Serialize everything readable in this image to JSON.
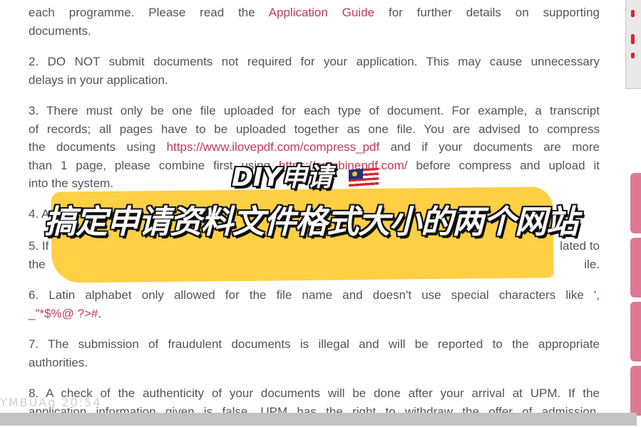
{
  "document": {
    "paragraphs": [
      {
        "id": "1",
        "lines": [
          {
            "segs": [
              {
                "t": "each programme. Please read the "
              },
              {
                "t": "Application Guide",
                "link": true
              },
              {
                "t": " for further details on supporting"
              }
            ]
          },
          {
            "segs": [
              {
                "t": "documents."
              }
            ],
            "last": true
          }
        ]
      },
      {
        "id": "2",
        "lines": [
          {
            "segs": [
              {
                "t": "2. DO NOT submit documents not required for your application. This may cause unnecessary"
              }
            ]
          },
          {
            "segs": [
              {
                "t": "delays in your application."
              }
            ],
            "last": true
          }
        ]
      },
      {
        "id": "3",
        "lines": [
          {
            "segs": [
              {
                "t": "3. There must only be one file uploaded for each type of document. For example, a transcript"
              }
            ]
          },
          {
            "segs": [
              {
                "t": "of records; all pages have to be uploaded together as one file. You are advised to compress"
              }
            ]
          },
          {
            "segs": [
              {
                "t": "the documents using "
              },
              {
                "t": "https://www.ilovepdf.com/compress_pdf",
                "link": true
              },
              {
                "t": " and if your documents are more"
              }
            ]
          },
          {
            "segs": [
              {
                "t": "than 1 page, please combine first using "
              },
              {
                "t": "https://combinepdf.com/",
                "link": true
              },
              {
                "t": " before compress and upload it"
              }
            ]
          },
          {
            "segs": [
              {
                "t": "into the system."
              }
            ],
            "last": true
          }
        ]
      },
      {
        "id": "4",
        "lines": [
          {
            "segs": [
              {
                "t": "4. A"
              }
            ],
            "last": true
          }
        ]
      },
      {
        "id": "5",
        "lines": [
          {
            "segs": [
              {
                "t": "5. If"
              }
            ],
            "tail": "lated to",
            "last": true
          },
          {
            "segs": [
              {
                "t": "the"
              }
            ],
            "tail": "ile.",
            "last": true
          }
        ]
      },
      {
        "id": "6",
        "lines": [
          {
            "segs": [
              {
                "t": "6. Latin alphabet only allowed for the file name and doesn't use special characters like "
              },
              {
                "t": "',",
                "link": true
              }
            ]
          },
          {
            "segs": [
              {
                "t": "_\"*$%@ ?>#",
                "link": true
              },
              {
                "t": "."
              }
            ],
            "last": true
          }
        ]
      },
      {
        "id": "7",
        "lines": [
          {
            "segs": [
              {
                "t": "7. The submission of fraudulent documents is illegal and will be reported to the appropriate"
              }
            ]
          },
          {
            "segs": [
              {
                "t": "authorities."
              }
            ],
            "last": true
          }
        ]
      },
      {
        "id": "8",
        "lines": [
          {
            "segs": [
              {
                "t": "8. A check of the authenticity of your documents will be done after your arrival at UPM. If the"
              }
            ]
          },
          {
            "segs": [
              {
                "t": "application information given is false, UPM has the right to withdraw the offer of admission."
              }
            ]
          }
        ]
      }
    ]
  },
  "overlay": {
    "title": "DIY申请",
    "flag_icon": "malaysia-flag",
    "subtitle": "搞定申请资料文件格式大小的两个网站",
    "highlight_color": "#ffd044"
  },
  "watermark": "YMBUAg 20:54",
  "colors": {
    "text": "#555555",
    "link": "#c23a55",
    "side_tab": "#dd7a93"
  }
}
